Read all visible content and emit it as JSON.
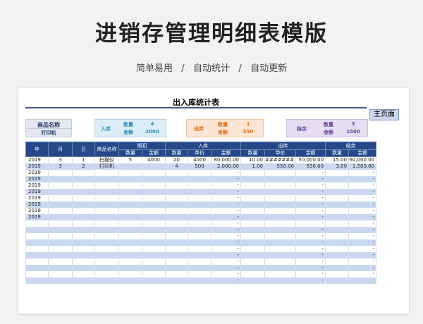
{
  "page_title": "进销存管理明细表模版",
  "tagline": "简单易用   /   自动统计   /   自动更新",
  "sheet_title": "出入库统计表",
  "home_button": "主页面",
  "summary": {
    "product_label": "商品名称",
    "product_value": "打印机",
    "inbound": {
      "label": "入库",
      "qty_label": "数量",
      "qty": "4",
      "amt_label": "金额",
      "amt": "2000"
    },
    "outbound": {
      "label": "出库",
      "qty_label": "数量",
      "qty": "1",
      "amt_label": "金额",
      "amt": "550"
    },
    "balance": {
      "label": "结余",
      "qty_label": "数量",
      "qty": "3",
      "amt_label": "金额",
      "amt": "1500"
    },
    "colors": {
      "inbound_bg": "#dcedf5",
      "inbound_text": "#2a8fb0",
      "outbound_bg": "#fbe5d4",
      "outbound_text": "#e06c12",
      "balance_bg": "#e4def0",
      "balance_text": "#6b3fa0",
      "product_bg": "#e4e8f0",
      "product_text": "#1f3864"
    }
  },
  "table": {
    "headers_top": [
      "年",
      "月",
      "日",
      "商品名称",
      "期初",
      "入库",
      "出库",
      "结余"
    ],
    "headers_sub": [
      "数量",
      "金额",
      "数量",
      "单价",
      "金额",
      "数量",
      "单价",
      "金额",
      "数量",
      "金额"
    ],
    "rows": [
      [
        "2019",
        "3",
        "1",
        "扫描仪",
        "5",
        "4000",
        "20",
        "4000",
        "80,000.00",
        "10.00",
        "#######",
        "50,000.00",
        "15.00",
        "60,000.00"
      ],
      [
        "2019",
        "3",
        "2",
        "打印机",
        "",
        "",
        "4",
        "500",
        "2,000.00",
        "1.00",
        "550.00",
        "550.00",
        "3.00",
        "1,500.00"
      ],
      [
        "2019",
        "",
        "",
        "",
        "",
        "",
        "",
        "",
        "-",
        "",
        "",
        "-",
        "",
        "-"
      ],
      [
        "2019",
        "",
        "",
        "",
        "",
        "",
        "",
        "",
        "-",
        "",
        "",
        "-",
        "",
        "-"
      ],
      [
        "2019",
        "",
        "",
        "",
        "",
        "",
        "",
        "",
        "-",
        "",
        "",
        "-",
        "",
        "-"
      ],
      [
        "2019",
        "",
        "",
        "",
        "",
        "",
        "",
        "",
        "-",
        "",
        "",
        "-",
        "",
        "-"
      ],
      [
        "2019",
        "",
        "",
        "",
        "",
        "",
        "",
        "",
        "-",
        "",
        "",
        "-",
        "",
        "-"
      ],
      [
        "2019",
        "",
        "",
        "",
        "",
        "",
        "",
        "",
        "-",
        "",
        "",
        "-",
        "",
        "-"
      ],
      [
        "2019",
        "",
        "",
        "",
        "",
        "",
        "",
        "",
        "-",
        "",
        "",
        "-",
        "",
        "-"
      ],
      [
        "2019",
        "",
        "",
        "",
        "",
        "",
        "",
        "",
        "-",
        "",
        "",
        "-",
        "",
        "-"
      ],
      [
        "",
        "",
        "",
        "",
        "",
        "",
        "",
        "",
        "-",
        "",
        "",
        "-",
        "",
        "-"
      ],
      [
        "",
        "",
        "",
        "",
        "",
        "",
        "",
        "",
        "-",
        "",
        "",
        "-",
        "",
        "-"
      ],
      [
        "",
        "",
        "",
        "",
        "",
        "",
        "",
        "",
        "-",
        "",
        "",
        "-",
        "",
        "-"
      ],
      [
        "",
        "",
        "",
        "",
        "",
        "",
        "",
        "",
        "-",
        "",
        "",
        "-",
        "",
        "-"
      ],
      [
        "",
        "",
        "",
        "",
        "",
        "",
        "",
        "",
        "-",
        "",
        "",
        "-",
        "",
        "-"
      ],
      [
        "",
        "",
        "",
        "",
        "",
        "",
        "",
        "",
        "-",
        "",
        "",
        "-",
        "",
        "-"
      ],
      [
        "",
        "",
        "",
        "",
        "",
        "",
        "",
        "",
        "-",
        "",
        "",
        "-",
        "",
        "-"
      ],
      [
        "",
        "",
        "",
        "",
        "",
        "",
        "",
        "",
        "-",
        "",
        "",
        "-",
        "",
        "-"
      ],
      [
        "",
        "",
        "",
        "",
        "",
        "",
        "",
        "",
        "-",
        "",
        "",
        "-",
        "",
        "-"
      ],
      [
        "",
        "",
        "",
        "",
        "",
        "",
        "",
        "",
        "-",
        "",
        "",
        "-",
        "",
        "-"
      ]
    ]
  }
}
